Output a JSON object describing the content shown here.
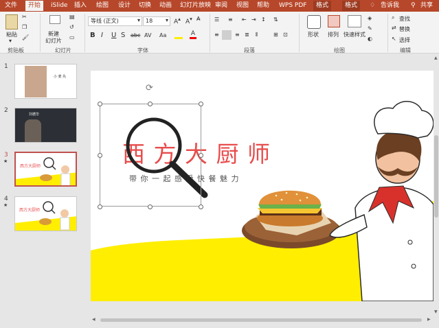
{
  "tabs": [
    {
      "label": "文件",
      "active": false
    },
    {
      "label": "开始",
      "active": true
    },
    {
      "label": "iSlide",
      "active": false
    },
    {
      "label": "插入",
      "active": false
    },
    {
      "label": "绘图",
      "active": false
    },
    {
      "label": "设计",
      "active": false
    },
    {
      "label": "切换",
      "active": false
    },
    {
      "label": "动画",
      "active": false
    },
    {
      "label": "幻灯片放映",
      "active": false
    },
    {
      "label": "审阅",
      "active": false
    },
    {
      "label": "视图",
      "active": false
    },
    {
      "label": "帮助",
      "active": false
    },
    {
      "label": "WPS PDF",
      "active": false
    },
    {
      "label": "格式",
      "active": false
    },
    {
      "label": "格式",
      "active": false
    }
  ],
  "tell_me": "告诉我",
  "share": "共享",
  "ribbon": {
    "paste": "粘贴",
    "new_slide": "新建",
    "new_slide2": "幻灯片",
    "font_name": "等线 (正文)",
    "font_size": "18",
    "shape": "形状",
    "arrange": "排列",
    "quick_styles": "快速样式",
    "find": "查找",
    "replace": "替换",
    "select": "选择",
    "groups": {
      "clipboard": "剪贴板",
      "slides": "幻灯片",
      "font": "字体",
      "paragraph": "段落",
      "drawing": "绘图",
      "editing": "编辑"
    },
    "font_buttons": [
      "B",
      "I",
      "U",
      "S",
      "abc",
      "AV",
      "Aa"
    ]
  },
  "slides": [
    {
      "number": "1",
      "star": "",
      "thumb_text": "小 麦 先"
    },
    {
      "number": "2",
      "star": "",
      "thumb_text": "刘德华"
    },
    {
      "number": "3",
      "star": "★",
      "thumb_text": "西方大厨师"
    },
    {
      "number": "4",
      "star": "★",
      "thumb_text": "西方大厨师"
    }
  ],
  "slide_title": "西 方 大 厨 师",
  "slide_subtitle": "带 你 一 起 感 受 快 餐 魅 力",
  "colors": {
    "accent": "#b7472a",
    "title_red": "#e84c4c",
    "yellow": "#ffee00"
  }
}
